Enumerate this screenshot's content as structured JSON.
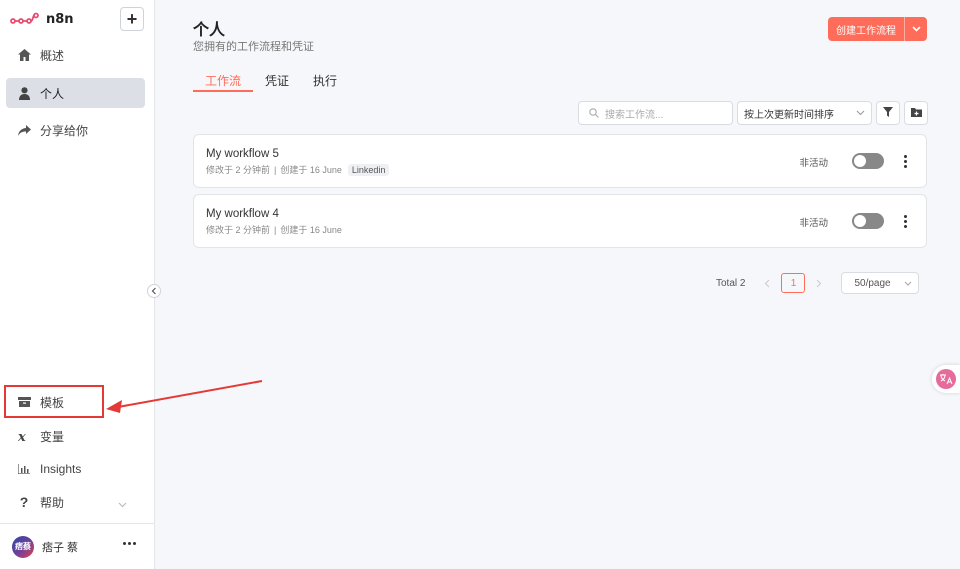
{
  "app": {
    "logo_text": "n8n",
    "add_label": "+"
  },
  "sidebar": {
    "items": [
      {
        "label": "概述",
        "icon": "home-icon"
      },
      {
        "label": "个人",
        "icon": "user-icon",
        "active": true
      },
      {
        "label": "分享给你",
        "icon": "share-icon"
      }
    ],
    "bottom_items": [
      {
        "label": "模板",
        "icon": "box-icon"
      },
      {
        "label": "变量",
        "icon": "variable-icon"
      },
      {
        "label": "Insights",
        "icon": "chart-icon"
      },
      {
        "label": "帮助",
        "icon": "question-icon"
      }
    ],
    "user": {
      "name": "痞子 蔡",
      "avatar_text": "痞蔡"
    }
  },
  "header": {
    "title": "个人",
    "subtitle": "您拥有的工作流程和凭证",
    "create_button": "创建工作流程"
  },
  "tabs": [
    {
      "label": "工作流",
      "active": true
    },
    {
      "label": "凭证"
    },
    {
      "label": "执行"
    }
  ],
  "toolbar": {
    "search_placeholder": "搜索工作流...",
    "sort_value": "按上次更新时间排序"
  },
  "workflows": [
    {
      "name": "My workflow 5",
      "modified": "修改于 2 分钟前",
      "separator": "|",
      "created": "创建于 16 June",
      "tag": "Linkedin",
      "status": "非活动"
    },
    {
      "name": "My workflow 4",
      "modified": "修改于 2 分钟前",
      "separator": "|",
      "created": "创建于 16 June",
      "status": "非活动"
    }
  ],
  "pagination": {
    "total": "Total 2",
    "current_page": "1",
    "page_size": "50/page"
  },
  "colors": {
    "accent": "#ff6d5a",
    "annotation": "#e53935"
  }
}
